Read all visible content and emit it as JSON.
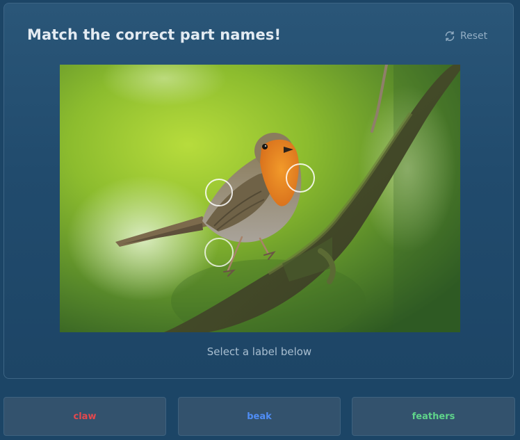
{
  "quiz": {
    "title": "Match the correct part names!",
    "reset_label": "Reset",
    "hint": "Select a label below",
    "hotspot_count": 3
  },
  "image": {
    "subject": "robin perched on a mossy branch"
  },
  "labels": [
    {
      "text": "claw",
      "color": "#e5484d"
    },
    {
      "text": "beak",
      "color": "#4f8df5"
    },
    {
      "text": "feathers",
      "color": "#5fd48a"
    }
  ],
  "colors": {
    "background": "#1c4566",
    "card_border": "#3d6585",
    "title": "#e3ebf2",
    "muted": "#93aec4"
  },
  "icons": {
    "reset": "refresh-icon"
  }
}
